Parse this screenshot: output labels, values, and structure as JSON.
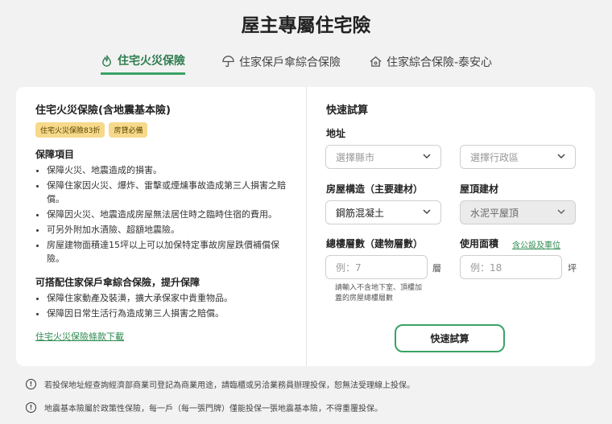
{
  "page_title": "屋主專屬住宅險",
  "tabs": [
    {
      "label": "住宅火災保險",
      "icon": "fire-icon",
      "active": true
    },
    {
      "label": "住家保戶傘綜合保險",
      "icon": "umbrella-icon",
      "active": false
    },
    {
      "label": "住家綜合保險-泰安心",
      "icon": "house-icon",
      "active": false
    }
  ],
  "plan": {
    "title": "住宅火災保險(含地震基本險)",
    "badges": [
      "住宅火災保險83折",
      "房貸必備"
    ],
    "coverage_heading": "保障項目",
    "coverage_items": [
      "保障火災、地震造成的損害。",
      "保障住家因火災、爆炸、雷擊或煙燻事故造成第三人損害之賠償。",
      "保障因火災、地震造成房屋無法居住時之臨時住宿的費用。",
      "可另外附加水漬險、超額地震險。",
      "房屋建物面積達15坪以上可以加保特定事故房屋跌價補償保險。"
    ],
    "addon_heading": "可搭配住家保戶傘綜合保險，提升保障",
    "addon_items": [
      "保障住家動產及裝潢，擴大承保家中貴重物品。",
      "保障因日常生活行為造成第三人損害之賠償。"
    ],
    "terms_link": "住宅火災保險條款下載"
  },
  "quick_calc": {
    "title": "快速試算",
    "address_label": "地址",
    "county_placeholder": "選擇縣市",
    "district_placeholder": "選擇行政區",
    "structure_label": "房屋構造（主要建材）",
    "structure_value": "鋼筋混凝土",
    "roof_label": "屋頂建材",
    "roof_value": "水泥平屋頂",
    "floors_label": "總樓層數（建物層數）",
    "floors_placeholder": "例：7",
    "floors_unit": "層",
    "floors_hint": "請輸入不含地下室、頂樓加蓋的房屋總樓層數",
    "area_label": "使用面積",
    "area_link": "含公設及車位",
    "area_placeholder": "例：18",
    "area_unit": "坪",
    "submit_label": "快速試算"
  },
  "notes": [
    "若投保地址經查詢經濟部商業司登記為商業用途，請臨櫃或另洽業務員辦理投保，恕無法受理線上投保。",
    "地震基本險屬於政策性保險，每一戶（每一張門牌）僅能投保一張地震基本險，不得重覆投保。"
  ],
  "colors": {
    "accent": "#3aa366",
    "badge": "#f6d98a"
  }
}
